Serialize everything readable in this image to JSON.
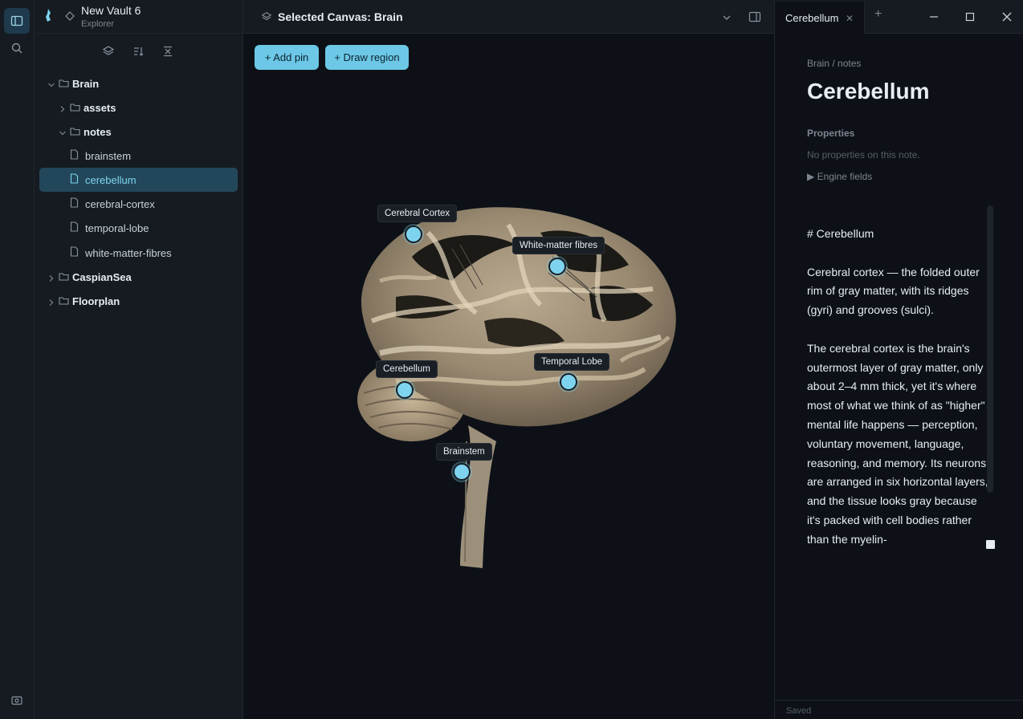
{
  "ribbon": {
    "items": [
      {
        "icon": "sidebar-toggle-icon",
        "active": true
      },
      {
        "icon": "search-icon",
        "active": false
      }
    ],
    "bottom_icon": "camera-icon"
  },
  "explorer": {
    "vault_name": "New Vault 6",
    "subtitle": "Explorer",
    "tools": [
      "layers-icon",
      "sort-icon",
      "collapse-all-icon"
    ],
    "tree": [
      {
        "label": "Brain",
        "type": "folder",
        "expanded": true,
        "depth": 0
      },
      {
        "label": "assets",
        "type": "folder",
        "expanded": false,
        "depth": 1
      },
      {
        "label": "notes",
        "type": "folder",
        "expanded": true,
        "depth": 1
      },
      {
        "label": "brainstem",
        "type": "file",
        "depth": 2
      },
      {
        "label": "cerebellum",
        "type": "file",
        "depth": 2,
        "selected": true
      },
      {
        "label": "cerebral-cortex",
        "type": "file",
        "depth": 2
      },
      {
        "label": "temporal-lobe",
        "type": "file",
        "depth": 2
      },
      {
        "label": "white-matter-fibres",
        "type": "file",
        "depth": 2
      },
      {
        "label": "CaspianSea",
        "type": "folder",
        "expanded": false,
        "depth": 0
      },
      {
        "label": "Floorplan",
        "type": "folder",
        "expanded": false,
        "depth": 0
      }
    ]
  },
  "canvas": {
    "title": "Selected Canvas: Brain",
    "add_pin": "+ Add pin",
    "draw_region": "+ Draw region",
    "pins": [
      {
        "label": "Cerebral Cortex"
      },
      {
        "label": "White-matter fibres"
      },
      {
        "label": "Cerebellum"
      },
      {
        "label": "Temporal Lobe"
      },
      {
        "label": "Brainstem"
      }
    ]
  },
  "note": {
    "tab_label": "Cerebellum",
    "breadcrumb": "Brain / notes",
    "title": "Cerebellum",
    "properties_heading": "Properties",
    "properties_empty": "No properties on this note.",
    "engine_fields": "▶ Engine fields",
    "body": [
      "# Cerebellum",
      "Cerebral cortex — the folded outer rim of gray matter, with its ridges (gyri) and grooves (sulci).",
      "The cerebral cortex is the brain's outermost layer of gray matter, only about 2–4 mm thick, yet it's where most of what we think of as \"higher\" mental life happens — perception, voluntary movement, language, reasoning, and memory. Its neurons are arranged in six horizontal layers, and the tissue looks gray because it's packed with cell bodies rather than the myelin-"
    ],
    "status": "Saved"
  },
  "colors": {
    "accent": "#6cc8e6",
    "pin": "#7ed4ee",
    "background": "#0d1117",
    "panel": "#161b22",
    "selected_row": "#23475a"
  }
}
